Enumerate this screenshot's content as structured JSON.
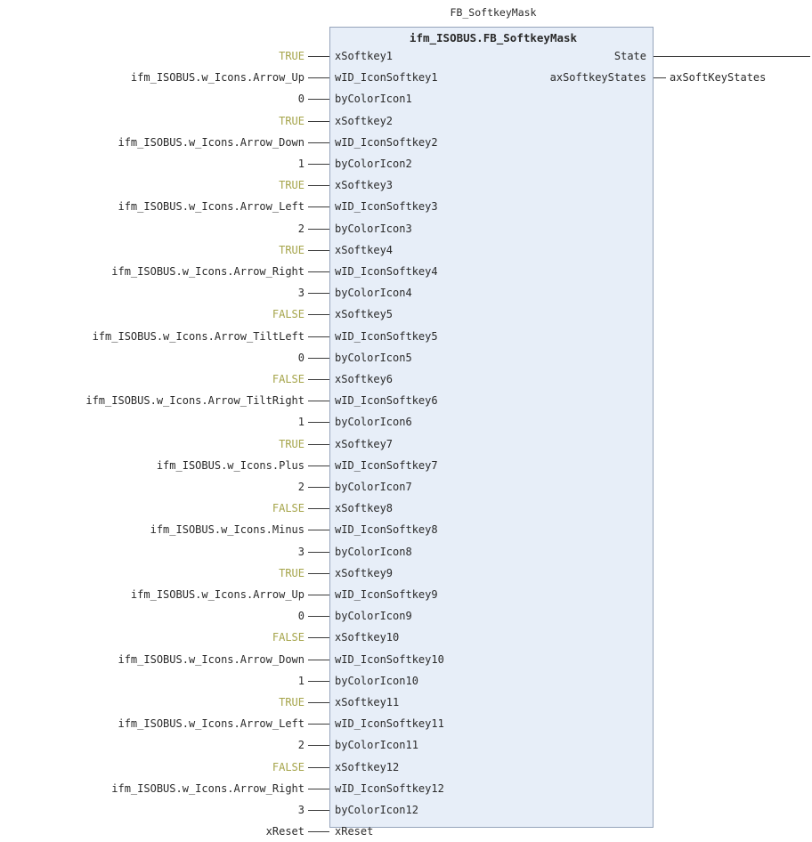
{
  "fb": {
    "instance_name": "FB_SoftkeyMask",
    "type_name": "ifm_ISOBUS.FB_SoftkeyMask"
  },
  "inputs": [
    {
      "pin": "xSoftkey1",
      "value": "TRUE",
      "kind": "bool"
    },
    {
      "pin": "wID_IconSoftkey1",
      "value": "ifm_ISOBUS.w_Icons.Arrow_Up",
      "kind": "text"
    },
    {
      "pin": "byColorIcon1",
      "value": "0",
      "kind": "text"
    },
    {
      "pin": "xSoftkey2",
      "value": "TRUE",
      "kind": "bool"
    },
    {
      "pin": "wID_IconSoftkey2",
      "value": "ifm_ISOBUS.w_Icons.Arrow_Down",
      "kind": "text"
    },
    {
      "pin": "byColorIcon2",
      "value": "1",
      "kind": "text"
    },
    {
      "pin": "xSoftkey3",
      "value": "TRUE",
      "kind": "bool"
    },
    {
      "pin": "wID_IconSoftkey3",
      "value": "ifm_ISOBUS.w_Icons.Arrow_Left",
      "kind": "text"
    },
    {
      "pin": "byColorIcon3",
      "value": "2",
      "kind": "text"
    },
    {
      "pin": "xSoftkey4",
      "value": "TRUE",
      "kind": "bool"
    },
    {
      "pin": "wID_IconSoftkey4",
      "value": "ifm_ISOBUS.w_Icons.Arrow_Right",
      "kind": "text"
    },
    {
      "pin": "byColorIcon4",
      "value": "3",
      "kind": "text"
    },
    {
      "pin": "xSoftkey5",
      "value": "FALSE",
      "kind": "bool"
    },
    {
      "pin": "wID_IconSoftkey5",
      "value": "ifm_ISOBUS.w_Icons.Arrow_TiltLeft",
      "kind": "text"
    },
    {
      "pin": "byColorIcon5",
      "value": "0",
      "kind": "text"
    },
    {
      "pin": "xSoftkey6",
      "value": "FALSE",
      "kind": "bool"
    },
    {
      "pin": "wID_IconSoftkey6",
      "value": "ifm_ISOBUS.w_Icons.Arrow_TiltRight",
      "kind": "text"
    },
    {
      "pin": "byColorIcon6",
      "value": "1",
      "kind": "text"
    },
    {
      "pin": "xSoftkey7",
      "value": "TRUE",
      "kind": "bool"
    },
    {
      "pin": "wID_IconSoftkey7",
      "value": "ifm_ISOBUS.w_Icons.Plus",
      "kind": "text"
    },
    {
      "pin": "byColorIcon7",
      "value": "2",
      "kind": "text"
    },
    {
      "pin": "xSoftkey8",
      "value": "FALSE",
      "kind": "bool"
    },
    {
      "pin": "wID_IconSoftkey8",
      "value": "ifm_ISOBUS.w_Icons.Minus",
      "kind": "text"
    },
    {
      "pin": "byColorIcon8",
      "value": "3",
      "kind": "text"
    },
    {
      "pin": "xSoftkey9",
      "value": "TRUE",
      "kind": "bool"
    },
    {
      "pin": "wID_IconSoftkey9",
      "value": "ifm_ISOBUS.w_Icons.Arrow_Up",
      "kind": "text"
    },
    {
      "pin": "byColorIcon9",
      "value": "0",
      "kind": "text"
    },
    {
      "pin": "xSoftkey10",
      "value": "FALSE",
      "kind": "bool"
    },
    {
      "pin": "wID_IconSoftkey10",
      "value": "ifm_ISOBUS.w_Icons.Arrow_Down",
      "kind": "text"
    },
    {
      "pin": "byColorIcon10",
      "value": "1",
      "kind": "text"
    },
    {
      "pin": "xSoftkey11",
      "value": "TRUE",
      "kind": "bool"
    },
    {
      "pin": "wID_IconSoftkey11",
      "value": "ifm_ISOBUS.w_Icons.Arrow_Left",
      "kind": "text"
    },
    {
      "pin": "byColorIcon11",
      "value": "2",
      "kind": "text"
    },
    {
      "pin": "xSoftkey12",
      "value": "FALSE",
      "kind": "bool"
    },
    {
      "pin": "wID_IconSoftkey12",
      "value": "ifm_ISOBUS.w_Icons.Arrow_Right",
      "kind": "text"
    },
    {
      "pin": "byColorIcon12",
      "value": "3",
      "kind": "text"
    },
    {
      "pin": "xReset",
      "value": "xReset",
      "kind": "text"
    }
  ],
  "outputs": [
    {
      "pin": "State",
      "value": ""
    },
    {
      "pin": "axSoftkeyStates",
      "value": "axSoftKeyStates"
    }
  ],
  "colors": {
    "block_fill": "#e7eef8",
    "block_border": "#95a4bb",
    "bool_literal": "#a5a44a",
    "wire": "#3b3b3b"
  }
}
